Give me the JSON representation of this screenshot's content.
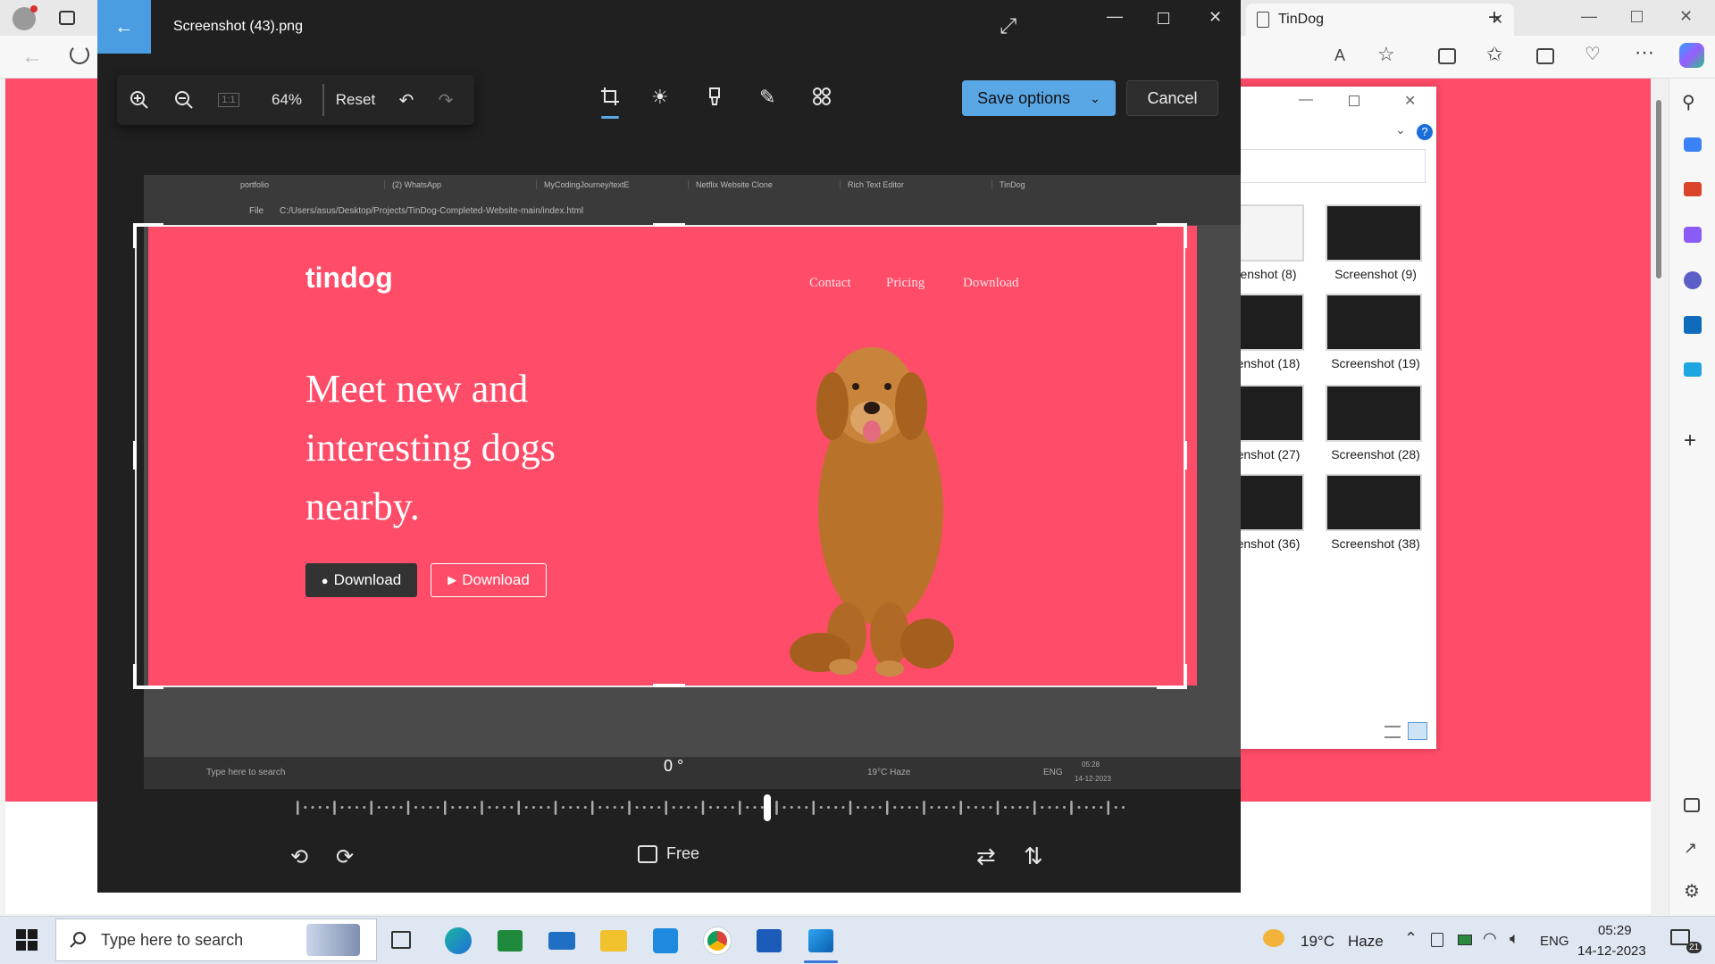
{
  "browser": {
    "tab_title": "TinDog"
  },
  "explorer": {
    "thumbnails": [
      {
        "label": "enshot (8)"
      },
      {
        "label": "Screenshot (9)"
      },
      {
        "label": "enshot (18)"
      },
      {
        "label": "Screenshot (19)"
      },
      {
        "label": "enshot (27)"
      },
      {
        "label": "Screenshot (28)"
      },
      {
        "label": "enshot (36)"
      },
      {
        "label": "Screenshot (38)"
      }
    ]
  },
  "photos": {
    "title": "Screenshot (43).png",
    "zoom": "64%",
    "reset_label": "Reset",
    "save_label": "Save options",
    "cancel_label": "Cancel",
    "rotation_label": "0 °",
    "aspect_label": "Free",
    "accent": "#5aa7e6"
  },
  "inner": {
    "tabs": [
      "portfolio",
      "(2) WhatsApp",
      "MyCodingJourney/textE",
      "Netflix Website Clone",
      "Rich Text Editor",
      "TinDog"
    ],
    "address": "C:/Users/asus/Desktop/Projects/TinDog-Completed-Website-main/index.html",
    "file_label": "File",
    "taskbar_search": "Type here to search",
    "taskbar_weather": "19°C  Haze",
    "taskbar_lang": "ENG",
    "taskbar_time": "05:28",
    "taskbar_date": "14-12-2023"
  },
  "site": {
    "logo": "tindog",
    "nav": [
      "Contact",
      "Pricing",
      "Download"
    ],
    "hero_lines": [
      "Meet new and",
      "interesting dogs",
      "nearby."
    ],
    "btn_apple": "Download",
    "btn_play": "Download",
    "brand_color": "#ff4c68"
  },
  "taskbar": {
    "search_placeholder": "Type here to search",
    "weather": "19°C",
    "weather_desc": "Haze",
    "lang": "ENG",
    "time": "05:29",
    "date": "14-12-2023",
    "notification_count": "21"
  }
}
